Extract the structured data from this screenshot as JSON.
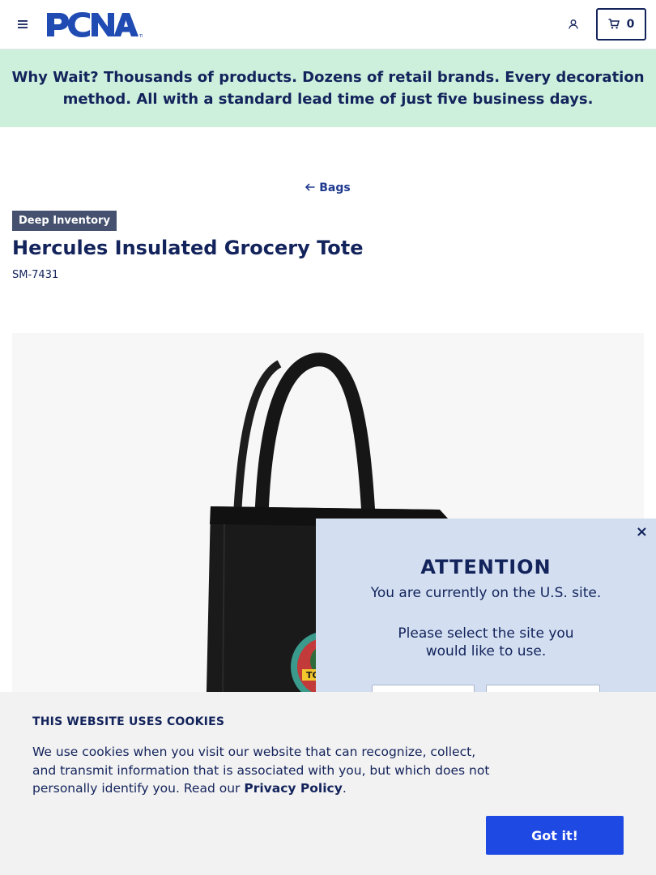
{
  "header": {
    "logo_text": "PCNA",
    "cart_count": "0",
    "icons": {
      "menu": "hamburger-menu-icon",
      "user": "user-icon",
      "cart": "cart-icon"
    }
  },
  "promo": {
    "lead": "Why Wait?",
    "text": " Thousands of products. Dozens of retail brands. Every decoration method. All with a standard lead time of just five business days."
  },
  "breadcrumb": {
    "back_label": "Bags",
    "icon": "arrow-left-icon"
  },
  "product": {
    "badge": "Deep Inventory",
    "title": "Hercules Insulated Grocery Tote",
    "sku": "SM-7431",
    "image_alt": "Black insulated grocery tote with a colorful circular logo"
  },
  "site_modal": {
    "close": "×",
    "heading": "ATTENTION",
    "message": "You are currently on the U.S. site.",
    "prompt": "Please select the site you would like to use."
  },
  "cookie_banner": {
    "title": "THIS WEBSITE USES COOKIES",
    "text": "We use cookies when you visit our website that can recognize, collect, and transmit information that is associated with you, but which does not personally identify you. Read our ",
    "link": "Privacy Policy",
    "after_link": ".",
    "button": "Got it!"
  },
  "colors": {
    "navy": "#13235b",
    "promo_bg": "#cdf0dd",
    "modal_bg": "#d3dff1",
    "cookie_bg": "#f2f2f2",
    "cta_blue": "#1e49e2"
  }
}
